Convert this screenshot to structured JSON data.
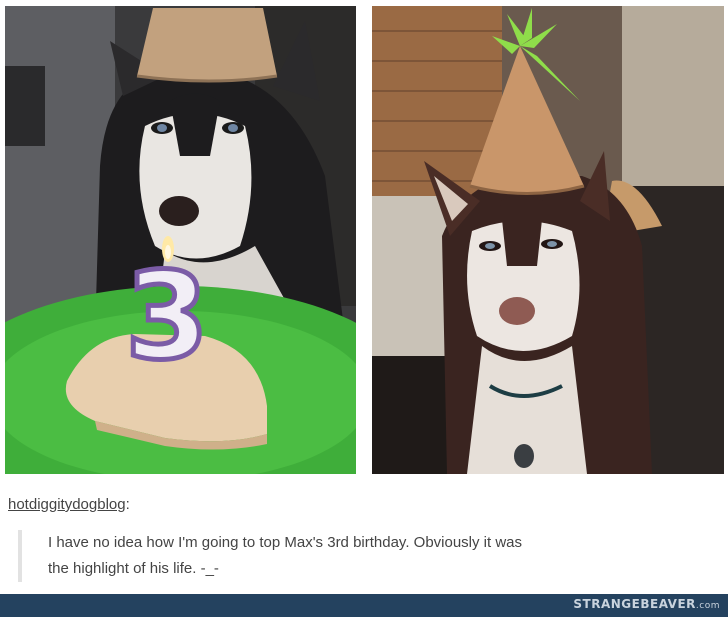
{
  "post": {
    "username": "hotdiggitydogblog",
    "username_suffix": ":",
    "quote_line_1": "I have no idea how I'm going to top Max's 3rd birthday. Obviously it was",
    "quote_line_2": "the highlight of his life. -_-"
  },
  "photos": {
    "left": {
      "candle_number": "3"
    },
    "right": {}
  },
  "watermark": {
    "brand": "STRANGEBEAVER",
    "domain": ".com"
  },
  "colors": {
    "footer_bar": "#24425f",
    "plate_green": "#3fae3a",
    "text": "#444444"
  }
}
